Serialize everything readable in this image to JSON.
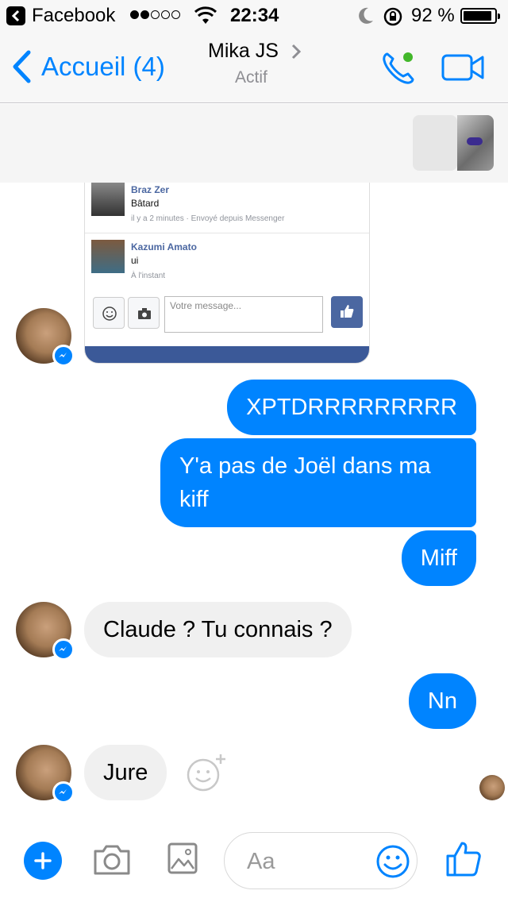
{
  "status_bar": {
    "back_app": "Facebook",
    "time": "22:34",
    "battery": "92 %",
    "battery_level": 0.92,
    "signal_bars_filled": 2,
    "signal_bars_total": 5
  },
  "nav": {
    "back_label": "Accueil (4)",
    "title": "Mika JS",
    "status": "Actif",
    "accent_color": "#0084ff",
    "online_color": "#42b72a"
  },
  "shared_screenshot": {
    "comments": [
      {
        "name": "Braz Zer",
        "text": "Bâtard",
        "meta": "il y a 2 minutes · Envoyé depuis Messenger"
      },
      {
        "name": "Kazumi Amato",
        "text": "ui",
        "meta": "À l'instant"
      }
    ],
    "composer_placeholder": "Votre message..."
  },
  "messages": [
    {
      "from": "me",
      "text": "XPTDRRRRRRRRR"
    },
    {
      "from": "me",
      "text": "Y'a pas de Joël dans ma kiff"
    },
    {
      "from": "me",
      "text": "Miff"
    },
    {
      "from": "them",
      "text": "Claude ? Tu connais ?"
    },
    {
      "from": "me",
      "text": "Nn"
    },
    {
      "from": "them",
      "text": "Jure"
    }
  ],
  "composer": {
    "placeholder": "Aa"
  },
  "icons": {
    "back": "chevron-left-icon",
    "call": "phone-icon",
    "video": "video-camera-icon",
    "plus": "plus-icon",
    "camera": "camera-icon",
    "gallery": "image-icon",
    "emoji": "smiley-icon",
    "like": "thumbs-up-icon",
    "messenger_badge": "messenger-icon"
  }
}
